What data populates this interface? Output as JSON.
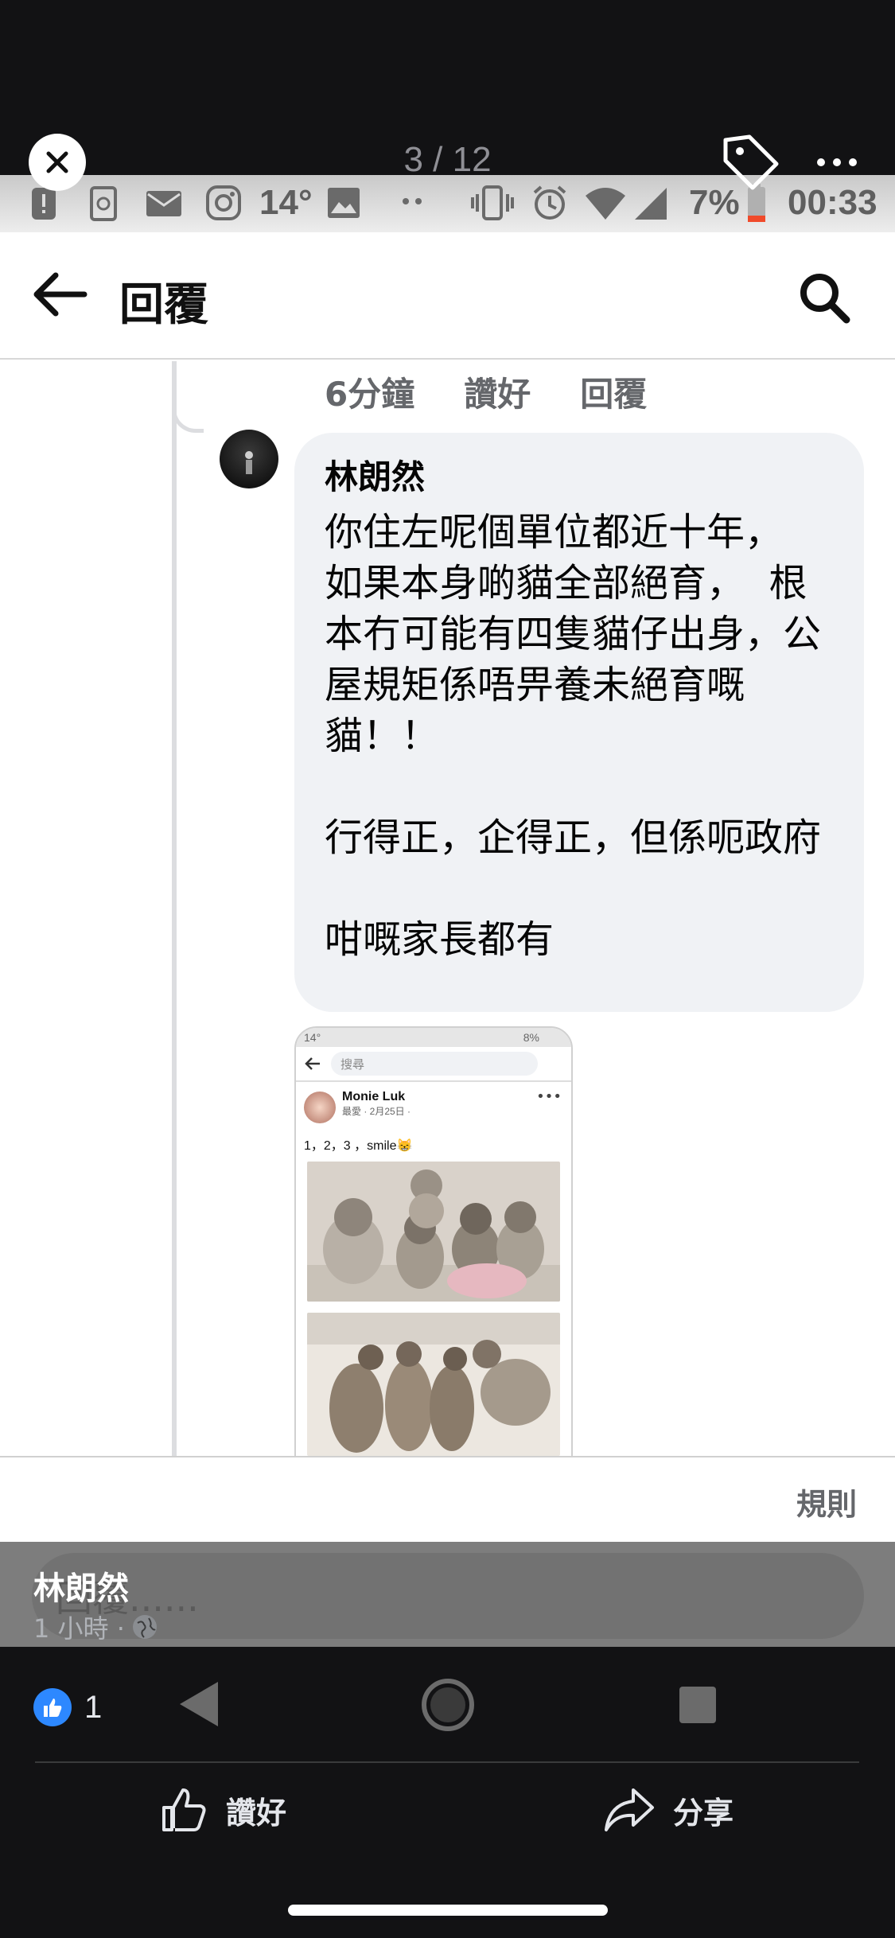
{
  "viewer": {
    "counter": "3 / 12"
  },
  "statusbar": {
    "temperature": "14°",
    "battery": "7%",
    "time": "00:33"
  },
  "appbar": {
    "title": "回覆"
  },
  "comment": {
    "actions": [
      "6分鐘",
      "讚好",
      "回覆"
    ],
    "author": "林朗然",
    "message": "你住左呢個單位都近十年，\n如果本身啲貓全部絕育，  根本冇可能有四隻貓仔出身，公屋規矩係唔畀養未絕育嘅貓！！\n\n行得正，企得正，但係呃政府\n\n咁嘅家長都有"
  },
  "attachment": {
    "status": "14°",
    "battery": "8%",
    "search_placeholder": "搜尋",
    "post_author": "Monie Luk",
    "post_meta": "最愛 · 2月25日 ·",
    "post_text": "1，2，3 ，smile😸"
  },
  "rules_label": "規則",
  "reply_placeholder": "回覆......",
  "owner": {
    "name": "林朗然",
    "time": "1 小時 ·"
  },
  "reactions": {
    "count": "1"
  },
  "bottom_actions": {
    "like": "讚好",
    "share": "分享"
  },
  "colors": {
    "accent": "#2d88ff",
    "bubble": "#f0f2f5",
    "dark_bg": "#121214"
  }
}
